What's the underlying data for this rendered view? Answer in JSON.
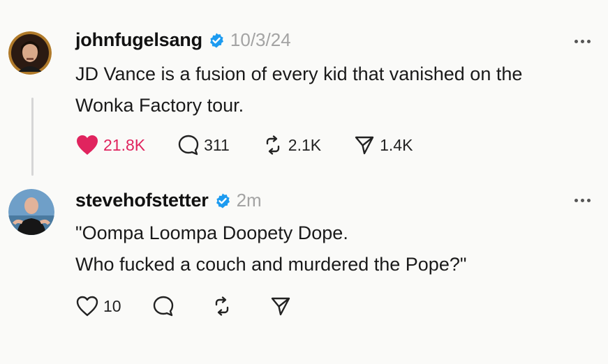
{
  "colors": {
    "liked": "#e0245e",
    "verified": "#1d9bf0",
    "muted": "#a3a3a3",
    "text": "#111111"
  },
  "posts": [
    {
      "username": "johnfugelsang",
      "verified": true,
      "timestamp": "10/3/24",
      "lines": [
        "JD Vance is a fusion of every kid that vanished on the",
        "Wonka Factory tour."
      ],
      "likes": "21.8K",
      "liked": true,
      "comments": "311",
      "reposts": "2.1K",
      "shares": "1.4K",
      "icons": [
        "heart-filled-icon",
        "comment-icon",
        "repost-icon",
        "share-icon"
      ]
    },
    {
      "username": "stevehofstetter",
      "verified": true,
      "timestamp": "2m",
      "lines": [
        "\"Oompa Loompa Doopety Dope.",
        "Who fucked a couch and murdered the Pope?\""
      ],
      "likes": "10",
      "liked": false,
      "icons": [
        "heart-outline-icon",
        "comment-icon",
        "repost-icon",
        "share-icon"
      ]
    }
  ]
}
